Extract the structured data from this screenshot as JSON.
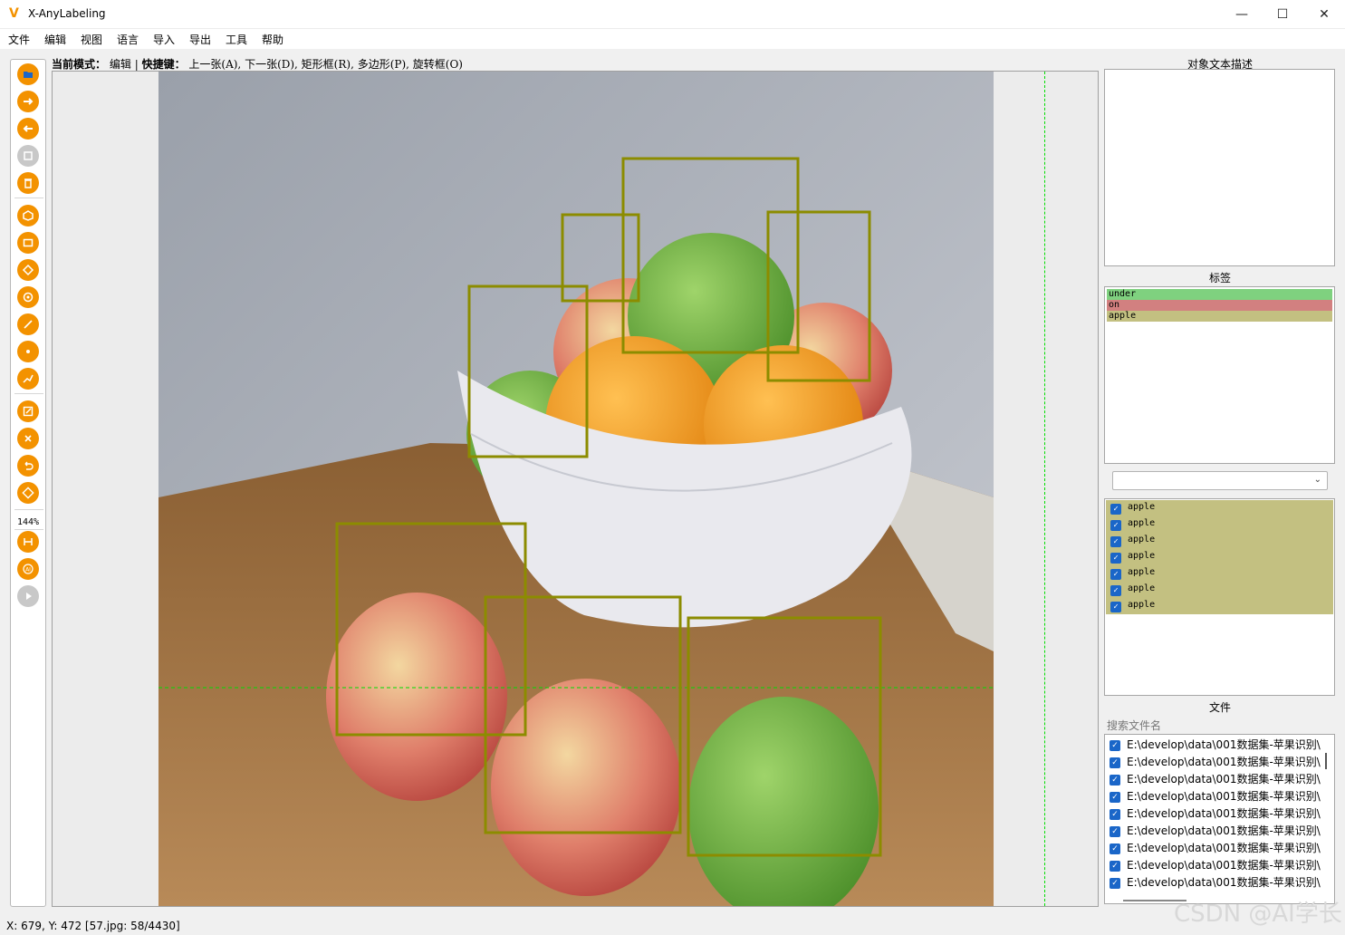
{
  "window": {
    "title": "X-AnyLabeling",
    "minimize_icon": "minimize-icon",
    "maximize_icon": "maximize-icon",
    "close_icon": "close-icon"
  },
  "menu": [
    "文件",
    "编辑",
    "视图",
    "语言",
    "导入",
    "导出",
    "工具",
    "帮助"
  ],
  "toolbar": {
    "zoom": "144%",
    "tools": [
      "open-folder-icon",
      "next-image-icon",
      "prev-image-icon",
      "save-icon",
      "delete-icon",
      "polygon-icon",
      "rectangle-icon",
      "rotation-icon",
      "circle-icon",
      "line-icon",
      "point-icon",
      "linestrip-icon",
      "edit-icon",
      "delete-shape-icon",
      "undo-icon",
      "brightness-icon",
      "fit-width-icon",
      "ai-icon",
      "run-icon"
    ]
  },
  "status": {
    "mode_label": "当前模式：",
    "mode_value": "编辑",
    "sep": "|",
    "shortcut_label": "快捷键：",
    "shortcut_value": "上一张(A), 下一张(D), 矩形框(R), 多边形(P), 旋转框(O)"
  },
  "panels": {
    "description_title": "对象文本描述",
    "labels_title": "标签",
    "files_title": "文件",
    "search_placeholder": "搜索文件名"
  },
  "label_list": [
    {
      "name": "under",
      "color": "#7fd17f"
    },
    {
      "name": "on",
      "color": "#d28080"
    },
    {
      "name": "apple",
      "color": "#c3c081"
    }
  ],
  "shape_list": [
    "apple",
    "apple",
    "apple",
    "apple",
    "apple",
    "apple",
    "apple"
  ],
  "file_list": [
    "E:\\develop\\data\\001数据集-苹果识别\\",
    "E:\\develop\\data\\001数据集-苹果识别\\",
    "E:\\develop\\data\\001数据集-苹果识别\\",
    "E:\\develop\\data\\001数据集-苹果识别\\",
    "E:\\develop\\data\\001数据集-苹果识别\\",
    "E:\\develop\\data\\001数据集-苹果识别\\",
    "E:\\develop\\data\\001数据集-苹果识别\\",
    "E:\\develop\\data\\001数据集-苹果识别\\",
    "E:\\develop\\data\\001数据集-苹果识别\\"
  ],
  "statusbar": "X: 679, Y: 472 [57.jpg: 58/4430]",
  "watermark": "CSDN @AI学长",
  "colors": {
    "accent": "#f39200",
    "box": "#8c8c00",
    "crosshair": "#00dd00"
  }
}
